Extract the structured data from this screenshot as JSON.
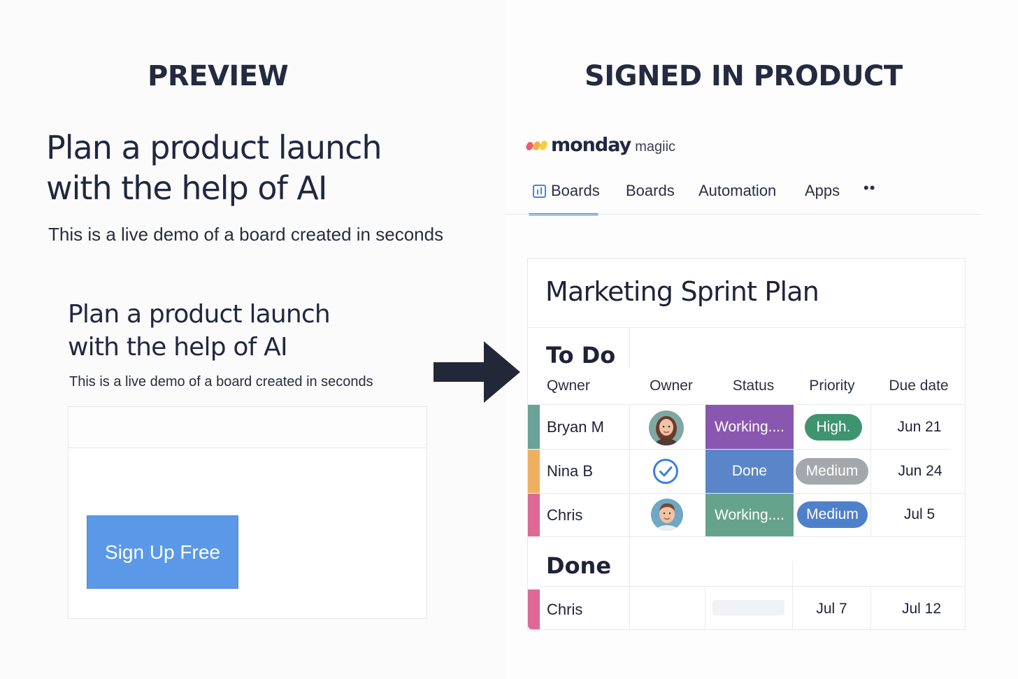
{
  "preview": {
    "column_title": "PREVIEW",
    "headline_line1": "Plan a product launch",
    "headline_line2": "with the help of AI",
    "subtitle": "This is a live demo of a board created in  seconds",
    "card_headline_line1": "Plan a product launch",
    "card_headline_line2": "with the help of AI",
    "card_subtitle": "This is a live demo of a board created in seconds",
    "signup_label": "Sign Up Free",
    "accent_color": "#5b99e8"
  },
  "product": {
    "column_title": "SIGNED IN PRODUCT",
    "logo": {
      "word": "monday",
      "sub": "magiic"
    },
    "nav": {
      "items": [
        {
          "label": "Boards",
          "icon": "board-icon",
          "active": true
        },
        {
          "label": "Boards"
        },
        {
          "label": "Automation"
        },
        {
          "label": "Apps"
        },
        {
          "label": "••",
          "icon": "more-icon"
        }
      ]
    },
    "board": {
      "title": "Marketing Sprint Plan",
      "columns": [
        "Qwner",
        "Owner",
        "Status",
        "Priority",
        "Due date"
      ],
      "groups": [
        {
          "title": "To Do",
          "rows": [
            {
              "name": "Bryan M",
              "owner": "avatar-woman",
              "status": "Working....",
              "status_color": "#8a57b0",
              "priority": "High.",
              "priority_color": "#3f9470",
              "due": "Jun 21",
              "bar_color": "#6aa397"
            },
            {
              "name": "Nina B",
              "owner": "check-icon",
              "status": "Done",
              "status_color": "#5a86c9",
              "priority": "Medium",
              "priority_color": "#a4a7ab",
              "due": "Jun 24",
              "bar_color": "#eeb060"
            },
            {
              "name": "Chris",
              "owner": "avatar-man",
              "status": "Working....",
              "status_color": "#66a38d",
              "priority": "Medium",
              "priority_color": "#4f80cc",
              "due": "Jul 5",
              "bar_color": "#dc6a95"
            }
          ]
        },
        {
          "title": "Done",
          "rows": [
            {
              "name": "Chris",
              "status": "",
              "priority": "Jul 7",
              "due": "Jul 12",
              "bar_color": "#dc6a95"
            }
          ]
        }
      ]
    }
  }
}
